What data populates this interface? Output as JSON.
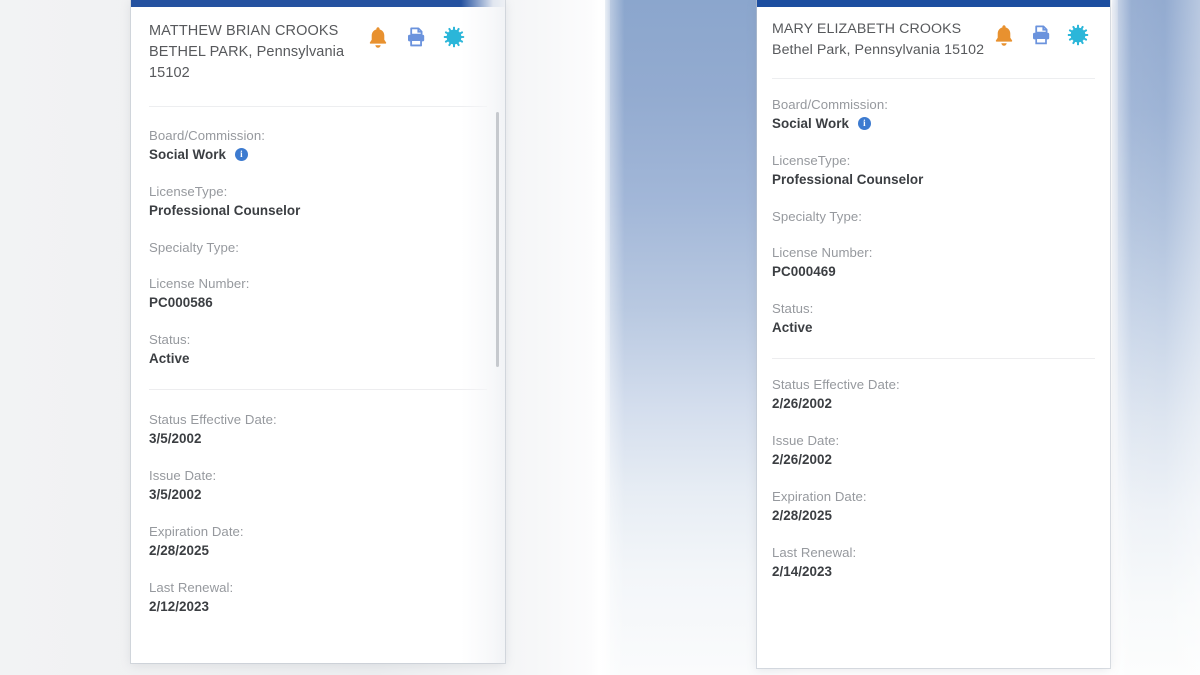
{
  "theme": {
    "topbar_blue": "#2552a0",
    "bell_orange": "#e8912f",
    "printer_blue": "#6b93dd",
    "badge_cyan": "#2bb6d9",
    "info_blue": "#3d7bd0",
    "label_gray": "#96999e",
    "value_gray": "#3b3e42"
  },
  "cards": [
    {
      "id": "left",
      "header": {
        "name": "MATTHEW BRIAN CROOKS",
        "address_line": "BETHEL PARK, Pennsylvania",
        "address_line2": "15102",
        "icons": [
          {
            "name": "bell-icon",
            "label": "Notifications"
          },
          {
            "name": "printer-icon",
            "label": "Print"
          },
          {
            "name": "verified-badge-icon",
            "label": "Verified"
          }
        ]
      },
      "fields_upper": [
        {
          "label": "Board/Commission:",
          "value": "Social Work",
          "has_info": true
        },
        {
          "label": "LicenseType:",
          "value": "Professional Counselor",
          "has_info": false
        },
        {
          "label": "Specialty Type:",
          "value": "",
          "has_info": false
        },
        {
          "label": "License Number:",
          "value": "PC000586",
          "has_info": false
        },
        {
          "label": "Status:",
          "value": "Active",
          "has_info": false
        }
      ],
      "fields_lower": [
        {
          "label": "Status Effective Date:",
          "value": "3/5/2002"
        },
        {
          "label": "Issue Date:",
          "value": "3/5/2002"
        },
        {
          "label": "Expiration Date:",
          "value": "2/28/2025"
        },
        {
          "label": "Last Renewal:",
          "value": "2/12/2023"
        }
      ]
    },
    {
      "id": "right",
      "header": {
        "name": "MARY ELIZABETH CROOKS",
        "address_line": "Bethel Park, Pennsylvania 15102",
        "address_line2": "",
        "icons": [
          {
            "name": "bell-icon",
            "label": "Notifications"
          },
          {
            "name": "printer-icon",
            "label": "Print"
          },
          {
            "name": "verified-badge-icon",
            "label": "Verified"
          }
        ]
      },
      "fields_upper": [
        {
          "label": "Board/Commission:",
          "value": "Social Work",
          "has_info": true
        },
        {
          "label": "LicenseType:",
          "value": "Professional Counselor",
          "has_info": false
        },
        {
          "label": "Specialty Type:",
          "value": "",
          "has_info": false
        },
        {
          "label": "License Number:",
          "value": "PC000469",
          "has_info": false
        },
        {
          "label": "Status:",
          "value": "Active",
          "has_info": false
        }
      ],
      "fields_lower": [
        {
          "label": "Status Effective Date:",
          "value": "2/26/2002"
        },
        {
          "label": "Issue Date:",
          "value": "2/26/2002"
        },
        {
          "label": "Expiration Date:",
          "value": "2/28/2025"
        },
        {
          "label": "Last Renewal:",
          "value": "2/14/2023"
        }
      ]
    }
  ]
}
